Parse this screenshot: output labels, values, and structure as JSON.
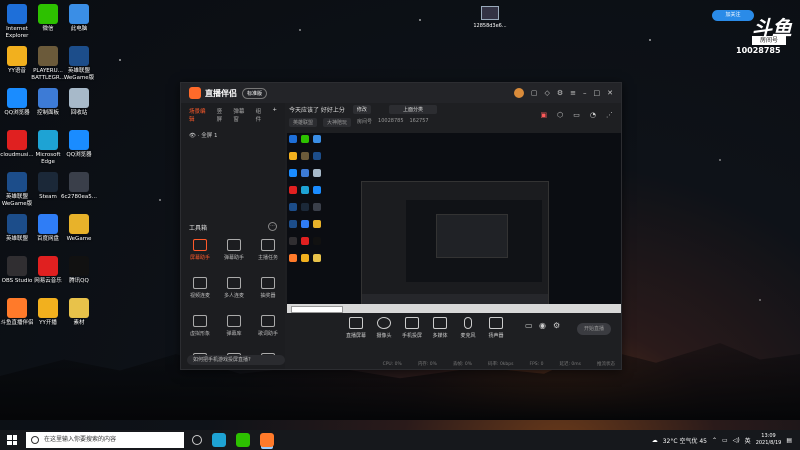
{
  "desktop": {
    "icons": [
      {
        "label": "Internet\nExplorer",
        "color": "#1e6fd9"
      },
      {
        "label": "微信",
        "color": "#2dc100"
      },
      {
        "label": "此电脑",
        "color": "#3a8ee6"
      },
      {
        "label": "YY语音",
        "color": "#f2b01e"
      },
      {
        "label": "PLAYERU...\nBATTLEGR...",
        "color": "#6b5a3a"
      },
      {
        "label": "英雄联盟\nWeGame版",
        "color": "#1c4d8a"
      },
      {
        "label": "QQ浏览器",
        "color": "#1a8cff"
      },
      {
        "label": "控制面板",
        "color": "#3d7bd6"
      },
      {
        "label": "回收站",
        "color": "#a7b9c9"
      },
      {
        "label": "cloudmusi...",
        "color": "#e02020"
      },
      {
        "label": "Microsoft\nEdge",
        "color": "#1ea3d4"
      },
      {
        "label": "QQ浏览器",
        "color": "#1a8cff"
      },
      {
        "label": "英雄联盟\nWeGame版",
        "color": "#1c4d8a"
      },
      {
        "label": "Steam",
        "color": "#1b2838"
      },
      {
        "label": "6c2780ea5...",
        "color": "#3a3f4a"
      },
      {
        "label": "英雄联盟",
        "color": "#1c4d8a"
      },
      {
        "label": "百度网盘",
        "color": "#2f7df6"
      },
      {
        "label": "WeGame",
        "color": "#e8b22a"
      },
      {
        "label": "OBS Studio",
        "color": "#302e31"
      },
      {
        "label": "网易云音乐",
        "color": "#e02020"
      },
      {
        "label": "腾讯QQ",
        "color": "#111111"
      },
      {
        "label": "斗鱼直播伴侣",
        "color": "#ff7a2a"
      },
      {
        "label": "YY开播",
        "color": "#f2b01e"
      },
      {
        "label": "素材",
        "color": "#e8c24a"
      }
    ],
    "top_file": "12858d3e6...",
    "douyu": {
      "pill": "加关注",
      "logo": "斗鱼",
      "room_label": "房间号",
      "room_number": "10028785"
    }
  },
  "app": {
    "title": "直播伴侣",
    "badge": "标准版",
    "left_tabs": [
      "场景编辑",
      "竖屏",
      "弹幕窗",
      "组件"
    ],
    "scene_item": "全屏 1",
    "tools_title": "工具箱",
    "tools_more": "···",
    "tools": [
      {
        "label": "屏幕助手",
        "active": true
      },
      {
        "label": "弹幕助手",
        "active": false
      },
      {
        "label": "主播任务",
        "active": false
      },
      {
        "label": "视频连麦",
        "active": false
      },
      {
        "label": "多人连麦",
        "active": false
      },
      {
        "label": "抽奖器",
        "active": false
      },
      {
        "label": "虚拟形象",
        "active": false
      },
      {
        "label": "弹幕库",
        "active": false
      },
      {
        "label": "歌词助手",
        "active": false
      },
      {
        "label": "",
        "active": false
      },
      {
        "label": "",
        "active": false
      },
      {
        "label": "",
        "active": false
      }
    ],
    "notice": "如何把手机游戏投屏直播?",
    "stream_title": "今天应该了 好好上分",
    "edit_label": "修改",
    "category": "上面分类",
    "tags": [
      "英雄联盟",
      "大神陪玩"
    ],
    "stats": [
      "房间号",
      "10028785",
      "162757"
    ],
    "controls": [
      "直播屏幕",
      "摄像头",
      "手机投屏",
      "多媒体",
      "麦克风",
      "扬声器"
    ],
    "start_button": "开始直播",
    "status_items": [
      "CPU: 0%",
      "内存: 0%",
      "丢帧: 0%",
      "码率: 0kbps",
      "FPS: 0",
      "延迟: 0ms",
      "推流状态"
    ]
  },
  "taskbar": {
    "search_placeholder": "在这里输入你要搜索的内容",
    "weather": "32°C  空气优 45",
    "time": "13:09",
    "date": "2021/8/19"
  }
}
